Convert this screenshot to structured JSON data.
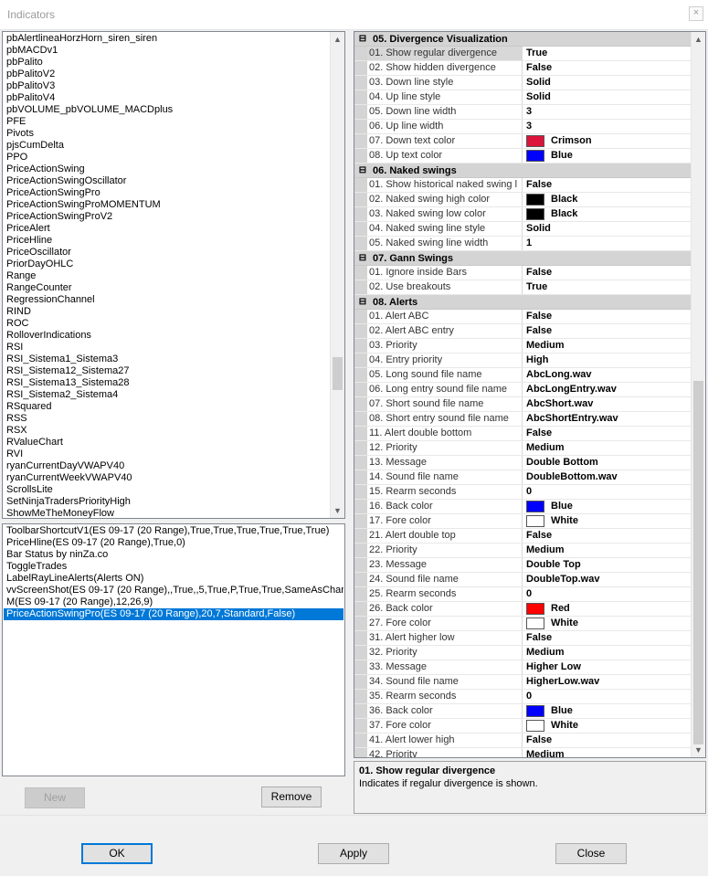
{
  "window": {
    "title": "Indicators",
    "close_glyph": "×"
  },
  "indicator_list": {
    "items": [
      "pbAlertlineaHorzHorn_siren_siren",
      "pbMACDv1",
      "pbPalito",
      "pbPalitoV2",
      "pbPalitoV3",
      "pbPalitoV4",
      "pbVOLUME_pbVOLUME_MACDplus",
      "PFE",
      "Pivots",
      "pjsCumDelta",
      "PPO",
      "PriceActionSwing",
      "PriceActionSwingOscillator",
      "PriceActionSwingPro",
      "PriceActionSwingProMOMENTUM",
      "PriceActionSwingProV2",
      "PriceAlert",
      "PriceHline",
      "PriceOscillator",
      "PriorDayOHLC",
      "Range",
      "RangeCounter",
      "RegressionChannel",
      "RIND",
      "ROC",
      "RolloverIndications",
      "RSI",
      "RSI_Sistema1_Sistema3",
      "RSI_Sistema12_Sistema27",
      "RSI_Sistema13_Sistema28",
      "RSI_Sistema2_Sistema4",
      "RSquared",
      "RSS",
      "RSX",
      "RValueChart",
      "RVI",
      "ryanCurrentDayVWAPV40",
      "ryanCurrentWeekVWAPV40",
      "ScrollsLite",
      "SetNinjaTradersPriorityHigh",
      "ShowMeTheMoneyFlow"
    ]
  },
  "applied_list": {
    "items": [
      "ToolbarShortcutV1(ES 09-17 (20 Range),True,True,True,True,True,True)",
      "PriceHline(ES 09-17 (20 Range),True,0)",
      "Bar Status by ninZa.co",
      "ToggleTrades",
      "LabelRayLineAlerts(Alerts ON)",
      "vvScreenShot(ES 09-17 (20 Range),,True,,5,True,P,True,True,SameAsChart,F",
      "M(ES 09-17 (20 Range),12,26,9)",
      "PriceActionSwingPro(ES 09-17 (20 Range),20,7,Standard,False)"
    ],
    "selected_index": 7
  },
  "buttons": {
    "new": "New",
    "remove": "Remove",
    "ok": "OK",
    "apply": "Apply",
    "close": "Close"
  },
  "categories": [
    {
      "toggle": "⊟",
      "name": "05. Divergence Visualization",
      "rows": [
        {
          "name": "01. Show regular divergence",
          "value": "True",
          "selected": true
        },
        {
          "name": "02. Show hidden divergence",
          "value": "False"
        },
        {
          "name": "03. Down line style",
          "value": "Solid"
        },
        {
          "name": "04. Up line style",
          "value": "Solid"
        },
        {
          "name": "05. Down line width",
          "value": "3"
        },
        {
          "name": "06. Up line width",
          "value": "3"
        },
        {
          "name": "07. Down text color",
          "value": "Crimson",
          "color": "#dc143c"
        },
        {
          "name": "08. Up text color",
          "value": "Blue",
          "color": "#0000ff"
        }
      ]
    },
    {
      "toggle": "⊟",
      "name": "06. Naked swings",
      "rows": [
        {
          "name": "01. Show historical naked swing l",
          "value": "False"
        },
        {
          "name": "02. Naked swing high color",
          "value": "Black",
          "color": "#000000"
        },
        {
          "name": "03. Naked swing low color",
          "value": "Black",
          "color": "#000000"
        },
        {
          "name": "04. Naked swing line style",
          "value": "Solid"
        },
        {
          "name": "05. Naked swing line width",
          "value": "1"
        }
      ]
    },
    {
      "toggle": "⊟",
      "name": "07. Gann Swings",
      "rows": [
        {
          "name": "01. Ignore inside Bars",
          "value": "False"
        },
        {
          "name": "02. Use breakouts",
          "value": "True"
        }
      ]
    },
    {
      "toggle": "⊟",
      "name": "08. Alerts",
      "rows": [
        {
          "name": "01. Alert ABC",
          "value": "False"
        },
        {
          "name": "02. Alert ABC entry",
          "value": "False"
        },
        {
          "name": "03. Priority",
          "value": "Medium"
        },
        {
          "name": "04. Entry priority",
          "value": "High"
        },
        {
          "name": "05. Long sound file name",
          "value": "AbcLong.wav"
        },
        {
          "name": "06. Long entry sound file name",
          "value": "AbcLongEntry.wav"
        },
        {
          "name": "07. Short sound file name",
          "value": "AbcShort.wav"
        },
        {
          "name": "08. Short entry sound file name",
          "value": "AbcShortEntry.wav"
        },
        {
          "name": "11. Alert double bottom",
          "value": "False"
        },
        {
          "name": "12. Priority",
          "value": "Medium"
        },
        {
          "name": "13. Message",
          "value": "Double Bottom"
        },
        {
          "name": "14. Sound file name",
          "value": "DoubleBottom.wav"
        },
        {
          "name": "15. Rearm seconds",
          "value": "0"
        },
        {
          "name": "16. Back color",
          "value": "Blue",
          "color": "#0000ff"
        },
        {
          "name": "17. Fore color",
          "value": "White",
          "color": "#ffffff"
        },
        {
          "name": "21. Alert double top",
          "value": "False"
        },
        {
          "name": "22. Priority",
          "value": "Medium"
        },
        {
          "name": "23. Message",
          "value": "Double Top"
        },
        {
          "name": "24. Sound file name",
          "value": "DoubleTop.wav"
        },
        {
          "name": "25. Rearm seconds",
          "value": "0"
        },
        {
          "name": "26. Back color",
          "value": "Red",
          "color": "#ff0000"
        },
        {
          "name": "27. Fore color",
          "value": "White",
          "color": "#ffffff"
        },
        {
          "name": "31. Alert higher low",
          "value": "False"
        },
        {
          "name": "32. Priority",
          "value": "Medium"
        },
        {
          "name": "33. Message",
          "value": "Higher Low"
        },
        {
          "name": "34. Sound file name",
          "value": "HigherLow.wav"
        },
        {
          "name": "35. Rearm seconds",
          "value": "0"
        },
        {
          "name": "36. Back color",
          "value": "Blue",
          "color": "#0000ff"
        },
        {
          "name": "37. Fore color",
          "value": "White",
          "color": "#ffffff"
        },
        {
          "name": "41. Alert lower high",
          "value": "False"
        },
        {
          "name": "42. Priority",
          "value": "Medium"
        }
      ]
    }
  ],
  "description": {
    "title": "01. Show regular divergence",
    "text": "Indicates if regalur divergence is shown."
  },
  "scroll": {
    "up_glyph": "▲",
    "down_glyph": "▼"
  }
}
